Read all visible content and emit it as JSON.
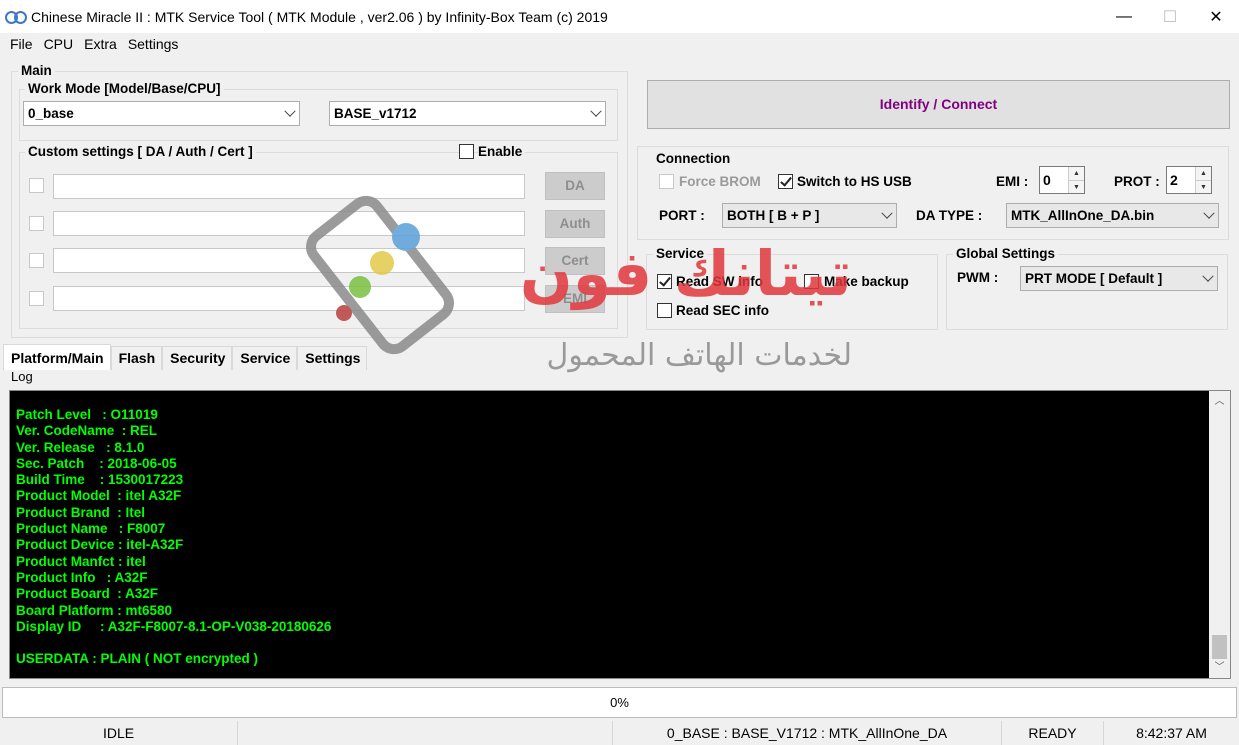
{
  "window": {
    "title": "Chinese Miracle II : MTK Service Tool ( MTK Module , ver2.06  ) by Infinity-Box Team (c) 2019",
    "minimize": "—",
    "maximize": "☐",
    "close": "✕"
  },
  "menu": [
    "File",
    "CPU",
    "Extra",
    "Settings"
  ],
  "main": {
    "group_label": "Main",
    "work_mode_label": "Work Mode [Model/Base/CPU]",
    "model_select": "0_base",
    "base_select": "BASE_v1712",
    "custom_label": "Custom settings [ DA / Auth / Cert ]",
    "enable_label": "Enable",
    "custom_rows": [
      {
        "button": "DA"
      },
      {
        "button": "Auth"
      },
      {
        "button": "Cert"
      },
      {
        "button": "EMI"
      }
    ]
  },
  "identify_button": "Identify / Connect",
  "connection": {
    "group_label": "Connection",
    "force_brom": "Force BROM",
    "switch_hs_usb": "Switch to HS USB",
    "emi_label": "EMI :",
    "emi_value": "0",
    "prot_label": "PROT :",
    "prot_value": "2",
    "port_label": "PORT :",
    "port_value": "BOTH [ B + P ]",
    "da_type_label": "DA TYPE :",
    "da_type_value": "MTK_AllInOne_DA.bin"
  },
  "service": {
    "group_label": "Service",
    "read_sw_info": "Read SW info",
    "make_backup": "Make backup",
    "read_sec_info": "Read SEC info"
  },
  "global_settings": {
    "group_label": "Global Settings",
    "pwm_label": "PWM :",
    "pwm_value": "PRT MODE [ Default ]"
  },
  "tabs": [
    "Platform/Main",
    "Flash",
    "Security",
    "Service",
    "Settings"
  ],
  "log": {
    "label": "Log",
    "lines": [
      "Patch Level   : O11019",
      "Ver. CodeName  : REL",
      "Ver. Release   : 8.1.0",
      "Sec. Patch    : 2018-06-05",
      "Build Time    : 1530017223",
      "Product Model  : itel A32F",
      "Product Brand  : Itel",
      "Product Name   : F8007",
      "Product Device : itel-A32F",
      "Product Manfct : itel",
      "Product Info   : A32F",
      "Product Board  : A32F",
      "Board Platform : mt6580",
      "Display ID     : A32F-F8007-8.1-OP-V038-20180626",
      "",
      "USERDATA : PLAIN ( NOT encrypted )"
    ]
  },
  "progress": {
    "text": "0%",
    "value": 0
  },
  "status": {
    "state": "IDLE",
    "empty": "",
    "config": "0_BASE : BASE_V1712 : MTK_AllInOne_DA",
    "ready": "READY",
    "time": "8:42:37 AM"
  },
  "watermark": {
    "brand": "تيتانك فون",
    "tagline": "لخدمات الهاتف المحمول"
  },
  "colors": {
    "log_text": "#00ff00",
    "log_bg": "#000000",
    "identify_text": "#800080",
    "watermark_red": "#e0373c"
  }
}
